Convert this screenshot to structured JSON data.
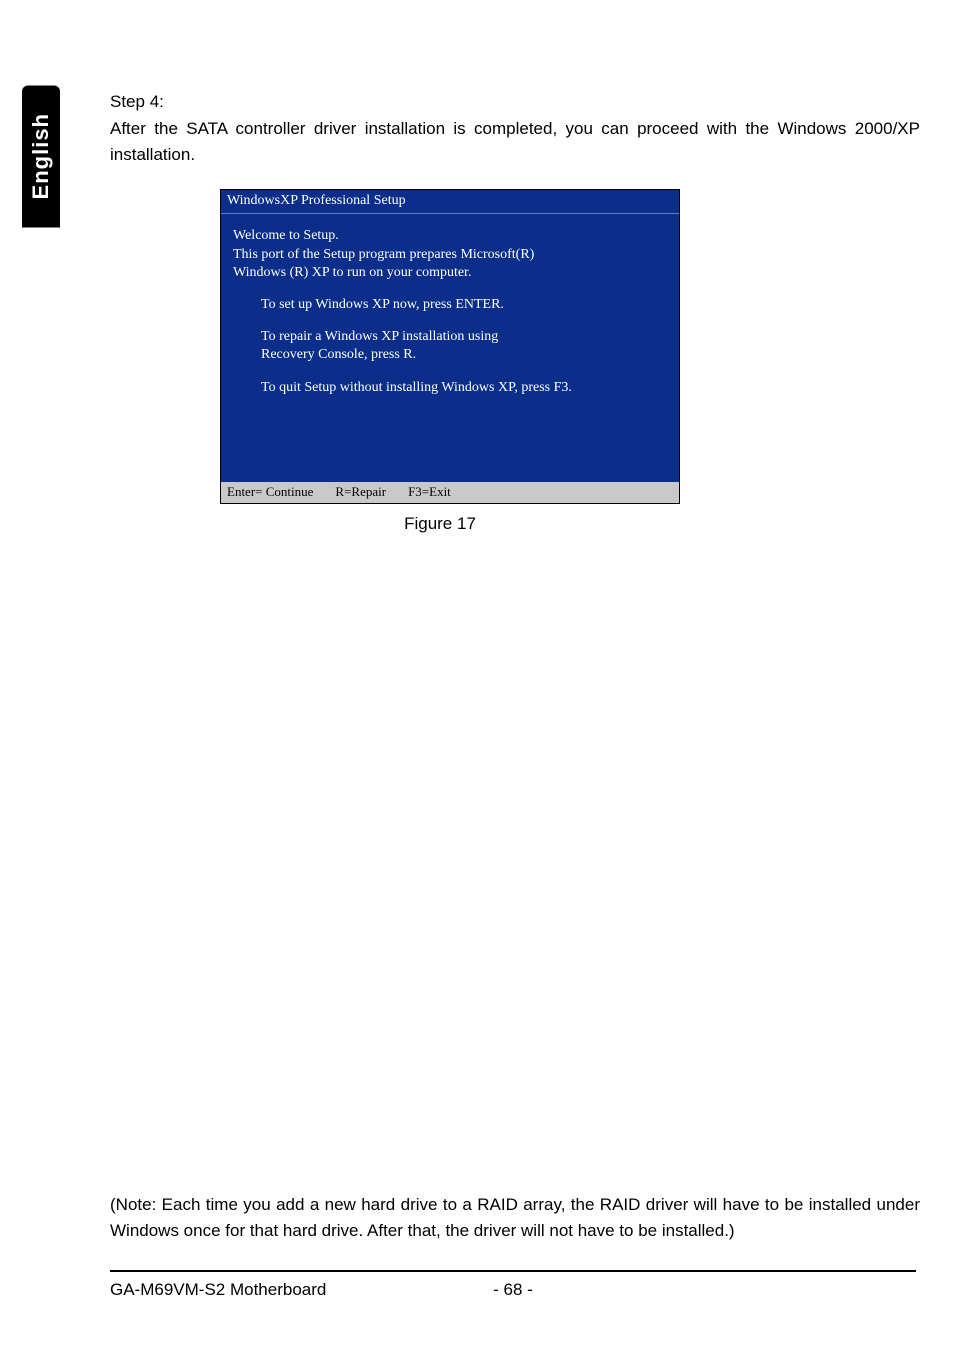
{
  "side_tab": "English",
  "step": {
    "title": "Step 4:",
    "body": "After the SATA controller driver installation is completed, you can proceed with the Windows 2000/XP installation."
  },
  "setup": {
    "header": "WindowsXP Professional  Setup",
    "welcome": "Welcome to Setup.",
    "intro1": "This port of the Setup program prepares Microsoft(R)",
    "intro2": "Windows (R) XP  to run on your computer.",
    "opt1": "To set up Windows XP now, press ENTER.",
    "opt2a": "To repair a Windows XP installation using",
    "opt2b": "Recovery Console, press R.",
    "opt3": "To quit Setup without installing Windows XP, press F3.",
    "footer": {
      "enter": "Enter= Continue",
      "r": "R=Repair",
      "f3": "F3=Exit"
    }
  },
  "figure_caption": "Figure 17",
  "note": "(Note: Each time you add a new hard drive to a RAID array, the RAID driver will have to be installed under Windows once for that hard drive. After that, the driver will not have to be installed.)",
  "footer": {
    "product": "GA-M69VM-S2 Motherboard",
    "page": "- 68 -"
  }
}
